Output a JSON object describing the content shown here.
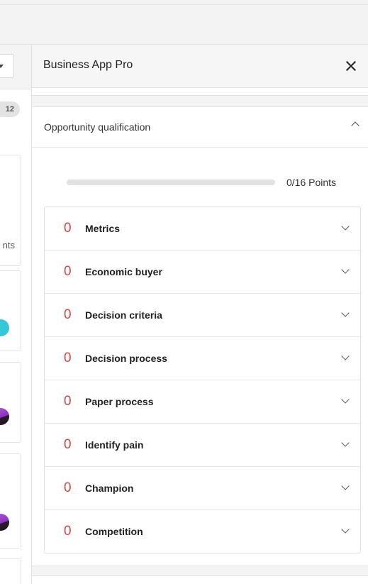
{
  "panel": {
    "title": "Business App Pro"
  },
  "board": {
    "column_count": "12",
    "card_text": "nts"
  },
  "qualification": {
    "title": "Opportunity qualification",
    "progress_fraction": 0,
    "points_label": "0/16 Points",
    "criteria": [
      {
        "score": "0",
        "label": "Metrics"
      },
      {
        "score": "0",
        "label": "Economic buyer"
      },
      {
        "score": "0",
        "label": "Decision criteria"
      },
      {
        "score": "0",
        "label": "Decision process"
      },
      {
        "score": "0",
        "label": "Paper process"
      },
      {
        "score": "0",
        "label": "Identify pain"
      },
      {
        "score": "0",
        "label": "Champion"
      },
      {
        "score": "0",
        "label": "Competition"
      }
    ]
  },
  "colors": {
    "score_red": "#d64545",
    "avatar_teal": "#35c8d8",
    "avatar_purple": "#a64bd1"
  }
}
